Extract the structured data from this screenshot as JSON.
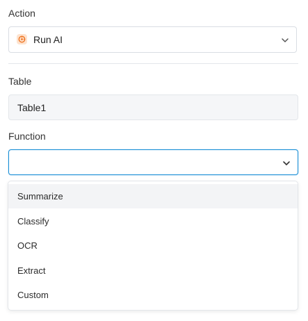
{
  "action": {
    "label": "Action",
    "value": "Run AI",
    "icon": "ai-icon"
  },
  "table": {
    "label": "Table",
    "value": "Table1"
  },
  "function": {
    "label": "Function",
    "value": "",
    "options": [
      "Summarize",
      "Classify",
      "OCR",
      "Extract",
      "Custom"
    ],
    "highlighted": "Summarize"
  },
  "colors": {
    "focus_border": "#1a8fd6",
    "ai_icon": "#f07a2a",
    "ai_icon_bg": "#fde3cf"
  }
}
